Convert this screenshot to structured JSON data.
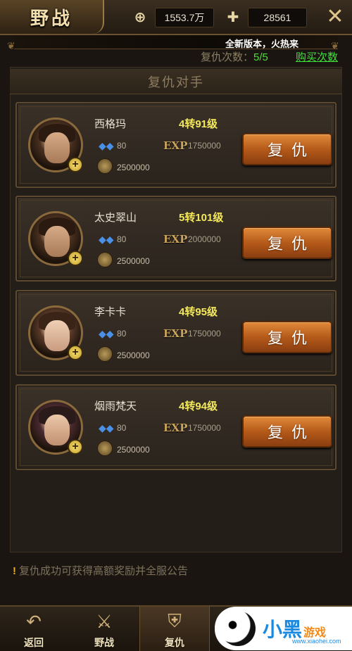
{
  "header": {
    "title": "野战",
    "gold_value": "1553.7万",
    "ingot_value": "28561"
  },
  "notice": "全新版本，火热来",
  "revenge": {
    "count_label": "复仇次数：",
    "count_value": "5/5",
    "buy_label": "购买次数"
  },
  "section_title": "复仇对手",
  "opponents": [
    {
      "name": "西格玛",
      "level": "4转91级",
      "gems": "80",
      "exp_label": "EXP",
      "exp": "1750000",
      "coins": "2500000",
      "button": "复仇"
    },
    {
      "name": "太史翠山",
      "level": "5转101级",
      "gems": "80",
      "exp_label": "EXP",
      "exp": "2000000",
      "coins": "2500000",
      "button": "复仇"
    },
    {
      "name": "李卡卡",
      "level": "4转95级",
      "gems": "80",
      "exp_label": "EXP",
      "exp": "1750000",
      "coins": "2500000",
      "button": "复仇"
    },
    {
      "name": "烟雨梵天",
      "level": "4转94级",
      "gems": "80",
      "exp_label": "EXP",
      "exp": "1750000",
      "coins": "2500000",
      "button": "复仇"
    }
  ],
  "tip": "复仇成功可获得高额奖励并全服公告",
  "nav": {
    "back": "返回",
    "field": "野战",
    "revenge": "复仇"
  },
  "watermark": {
    "brand": "小黑",
    "sub": "游戏",
    "url": "www.xiaohei.com"
  },
  "colors": {
    "accent_green": "#4fdc3c",
    "level_yellow": "#f4e95a",
    "button_orange": "#b55a1a"
  }
}
